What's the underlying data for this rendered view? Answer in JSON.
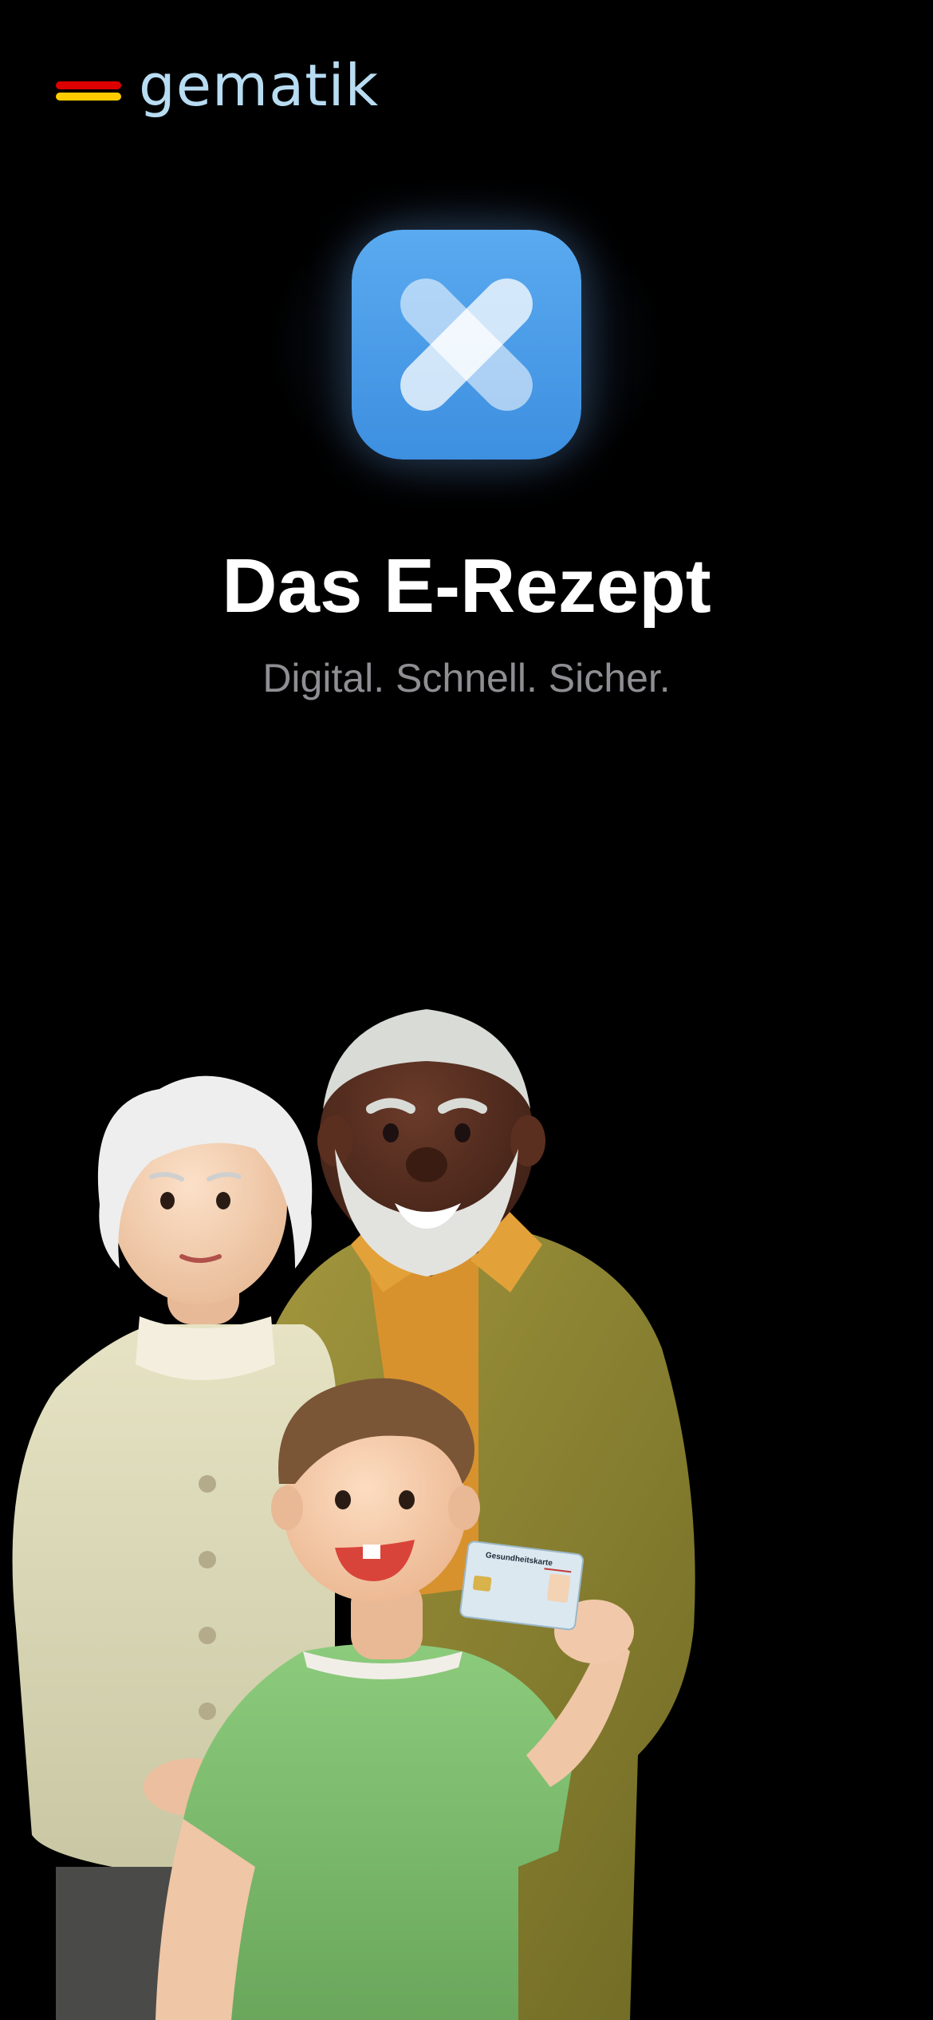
{
  "brand": {
    "name": "gematik",
    "name_color": "#b8dcf2",
    "flag_colors": [
      "#dd0000",
      "#ffcc00"
    ]
  },
  "app_icon": {
    "icon": "e-rezept-plaster-icon",
    "background_color": "#4a9ee8",
    "symbol_color": "#ffffff"
  },
  "main": {
    "title": "Das E-Rezept",
    "subtitle": "Digital. Schnell. Sicher.",
    "subtitle_color": "#8e8e93"
  },
  "illustration": {
    "card_title": "Gesundheitskarte"
  },
  "colors": {
    "background": "#000000",
    "title": "#ffffff"
  }
}
